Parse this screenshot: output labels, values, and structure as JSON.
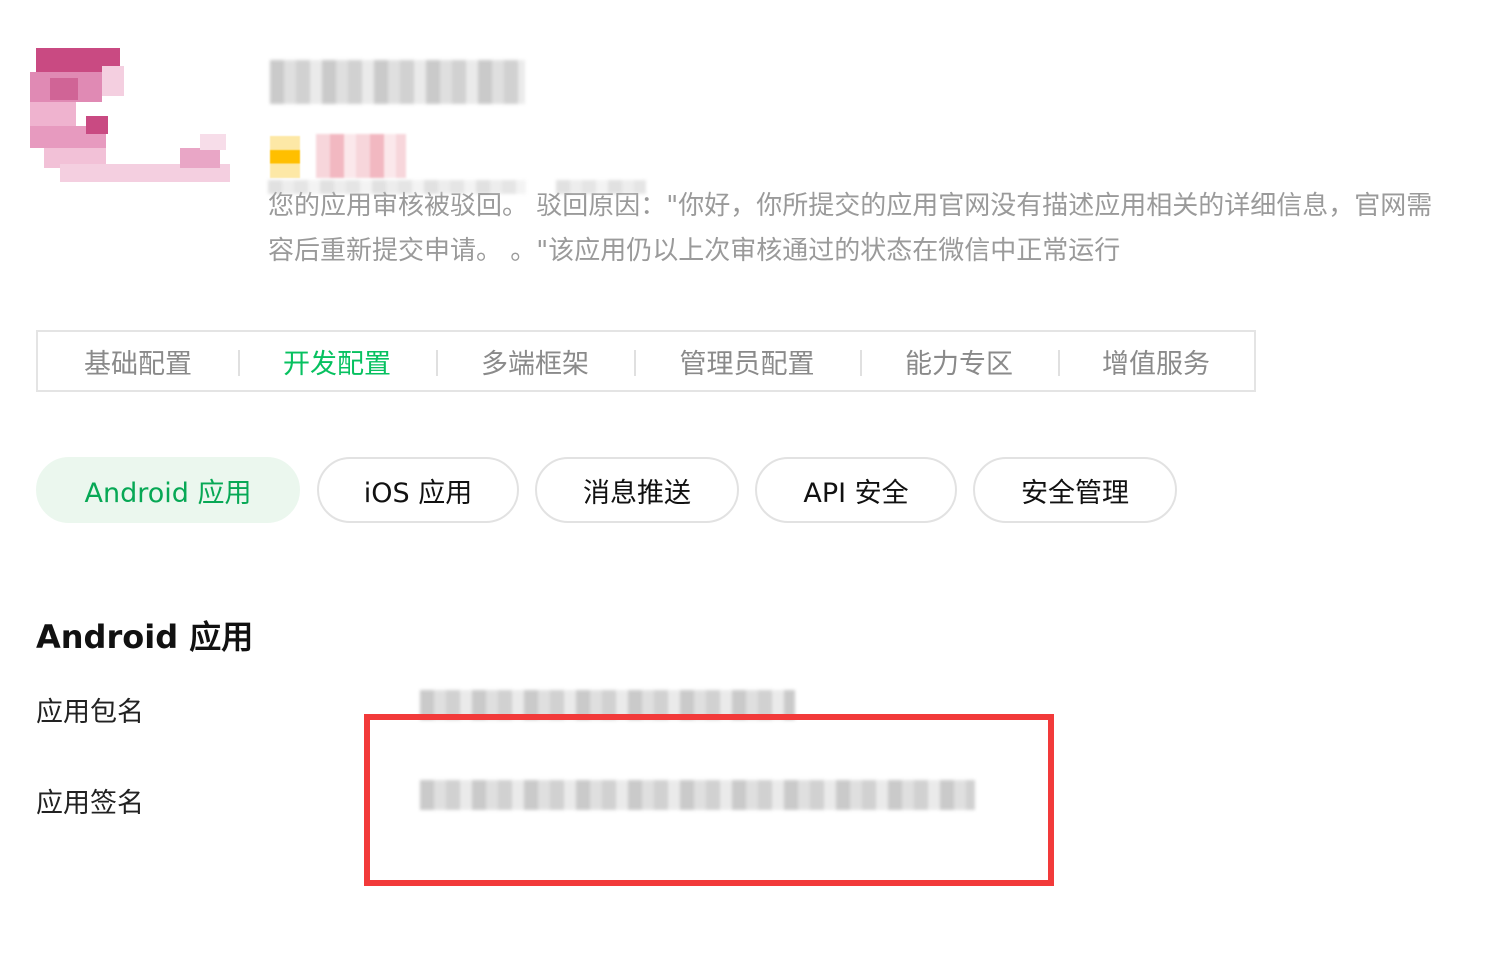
{
  "header": {
    "app_logo_icon": "app-logo-icon",
    "reject_message_line1": "您的应用审核被驳回。 驳回原因：\"你好，你所提交的应用官网没有描述应用相关的详细信息，官网需",
    "reject_message_line2": "容后重新提交申请。 。\"该应用仍以上次审核通过的状态在微信中正常运行",
    "status_color": "#ffbf00"
  },
  "main_tabs": [
    {
      "label": "基础配置"
    },
    {
      "label": "开发配置"
    },
    {
      "label": "多端框架"
    },
    {
      "label": "管理员配置"
    },
    {
      "label": "能力专区"
    },
    {
      "label": "增值服务"
    }
  ],
  "active_main_tab": "开发配置",
  "sub_tabs": [
    {
      "label": "Android 应用"
    },
    {
      "label": "iOS 应用"
    },
    {
      "label": "消息推送"
    },
    {
      "label": "API 安全"
    },
    {
      "label": "安全管理"
    }
  ],
  "active_sub_tab": "Android 应用",
  "section": {
    "title": "Android 应用",
    "fields": [
      {
        "label": "应用包名"
      },
      {
        "label": "应用签名"
      }
    ]
  },
  "colors": {
    "accent": "#07c160",
    "highlight": "#f23a3a",
    "pill_active_bg": "#ebf7ee"
  }
}
